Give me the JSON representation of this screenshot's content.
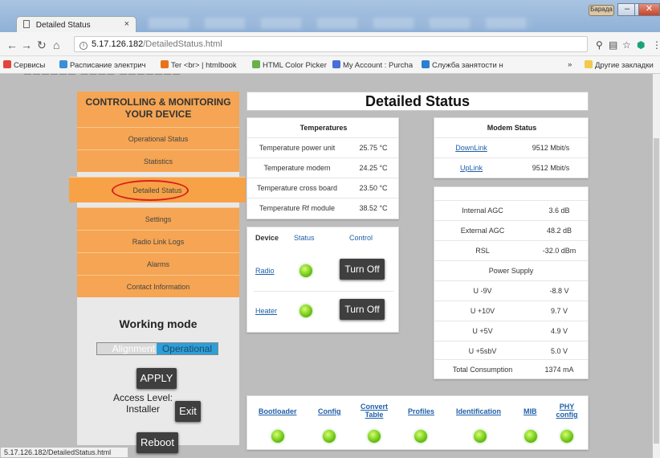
{
  "browser": {
    "tab_title": "Detailed Status",
    "tab_close": "×",
    "user_button": "Барада",
    "url_host": "5.17.126.182",
    "url_path": "/DetailedStatus.html",
    "status_url": "5.17.126.182/DetailedStatus.html",
    "bookmarks": [
      {
        "label": "Сервисы",
        "color": "#e0463e"
      },
      {
        "label": "Расписание электрич",
        "color": "#3a8fd6"
      },
      {
        "label": "Ter <br> | htmlbook",
        "color": "#e8731a"
      },
      {
        "label": "HTML Color Picker",
        "color": "#6ab04c"
      },
      {
        "label": "My Account : Purcha",
        "color": "#4a6fd8"
      },
      {
        "label": "Служба занятости н",
        "color": "#2b7fd0"
      }
    ],
    "bookmarks_more": "»",
    "other_bookmarks": "Другие закладки"
  },
  "sidebar": {
    "header": "CONTROLLING & MONITORING YOUR DEVICE",
    "menu": [
      "Operational Status",
      "Statistics",
      "Detailed Status",
      "Settings",
      "Radio Link Logs",
      "Alarms",
      "Contact Information"
    ],
    "working_mode_title": "Working mode",
    "mode_alignment": "Alignment",
    "mode_operational": "Operational",
    "apply": "APPLY",
    "access_level_label": "Access Level:",
    "access_level_value": "Installer",
    "exit": "Exit",
    "reboot": "Reboot"
  },
  "main": {
    "title": "Detailed Status",
    "temperatures": {
      "title": "Temperatures",
      "rows": [
        {
          "label": "Temperature power unit",
          "value": "25.75 °C"
        },
        {
          "label": "Temperature modem",
          "value": "24.25 °C"
        },
        {
          "label": "Temperature cross board",
          "value": "23.50 °C"
        },
        {
          "label": "Temperature Rf module",
          "value": "38.52 °C"
        }
      ]
    },
    "modem": {
      "title": "Modem Status",
      "rows": [
        {
          "label": "DownLink",
          "value": "9512 Mbit/s"
        },
        {
          "label": "UpLink",
          "value": "9512 Mbit/s"
        }
      ]
    },
    "device": {
      "col_device": "Device",
      "col_status": "Status",
      "col_control": "Control",
      "rows": [
        {
          "name": "Radio",
          "action": "Turn Off",
          "status": "on"
        },
        {
          "name": "Heater",
          "action": "Turn Off",
          "status": "on"
        }
      ]
    },
    "power": {
      "rows": [
        {
          "label": "Internal AGC",
          "value": "3.6 dB"
        },
        {
          "label": "External AGC",
          "value": "48.2 dB"
        },
        {
          "label": "RSL",
          "value": "-32.0 dBm"
        }
      ],
      "supply_title": "Power Supply",
      "supply_rows": [
        {
          "label": "U -9V",
          "value": "-8.8 V"
        },
        {
          "label": "U +10V",
          "value": "9.7 V"
        },
        {
          "label": "U +5V",
          "value": "4.9 V"
        },
        {
          "label": "U +5sbV",
          "value": "5.0 V"
        },
        {
          "label": "Total Consumption",
          "value": "1374 mA"
        }
      ]
    },
    "modules": [
      {
        "label": "Bootloader",
        "status": "on"
      },
      {
        "label": "Config",
        "status": "on"
      },
      {
        "label": "Convert Table",
        "status": "on"
      },
      {
        "label": "Profiles",
        "status": "on"
      },
      {
        "label": "Identification",
        "status": "on"
      },
      {
        "label": "MIB",
        "status": "on"
      },
      {
        "label": "PHY config",
        "status": "on"
      }
    ]
  }
}
